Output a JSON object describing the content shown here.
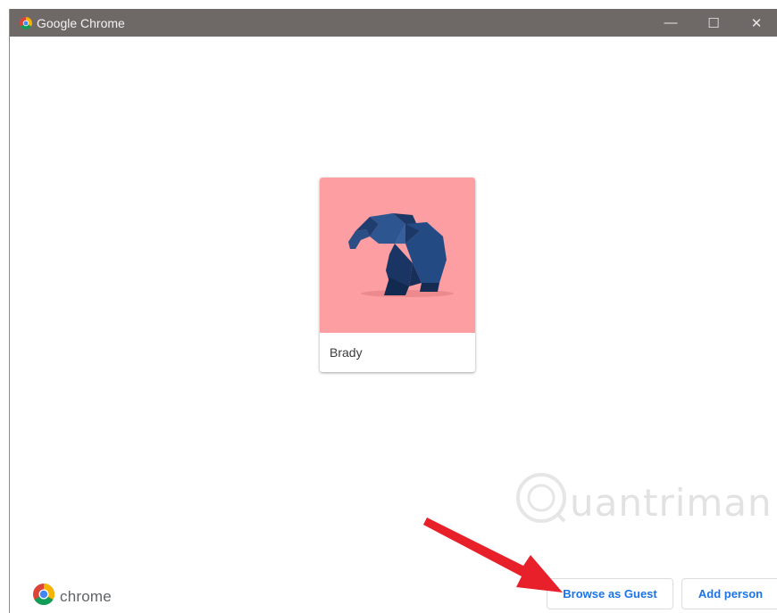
{
  "window": {
    "title": "Google Chrome",
    "controls": {
      "minimize": "—",
      "maximize": "☐",
      "close": "✕"
    }
  },
  "profiles": [
    {
      "name": "Brady",
      "avatar": "origami-elephant-icon",
      "avatar_bg": "#fd9ea2"
    }
  ],
  "footer": {
    "logo_text": "chrome",
    "browse_guest_label": "Browse as Guest",
    "add_person_label": "Add person"
  },
  "watermark_text": "Quantrimang",
  "colors": {
    "titlebar": "#6e6966",
    "accent": "#1a73e8",
    "arrow": "#e8202a"
  }
}
